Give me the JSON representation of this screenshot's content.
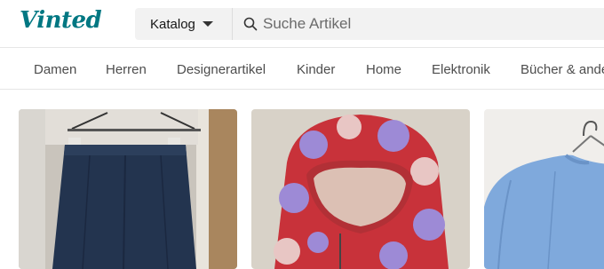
{
  "header": {
    "logo_text": "Vinted",
    "catalog_label": "Katalog",
    "search_placeholder": "Suche Artikel"
  },
  "nav": {
    "items": [
      "Damen",
      "Herren",
      "Designerartikel",
      "Kinder",
      "Home",
      "Elektronik",
      "Bücher & ande"
    ]
  },
  "colors": {
    "brand": "#007782",
    "search_bg": "#f2f2f2"
  },
  "products": [
    {
      "image": "navy-skirt-on-hanger"
    },
    {
      "image": "red-purple-fleece-hoodie"
    },
    {
      "image": "light-blue-knit-sweater"
    }
  ]
}
